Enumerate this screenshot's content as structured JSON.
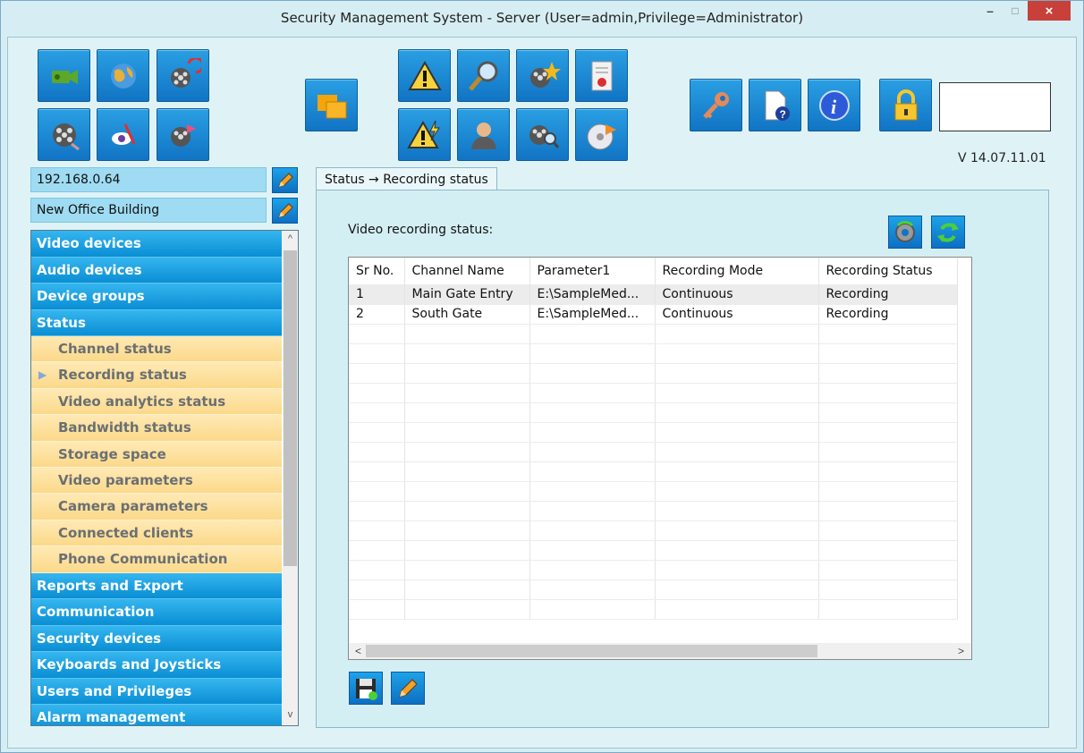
{
  "window": {
    "title": "Security Management System - Server (User=admin,Privilege=Administrator)",
    "min_label": "–",
    "max_label": "□",
    "close_label": "×"
  },
  "toolbar": {
    "buttons": [
      {
        "name": "camera-icon"
      },
      {
        "name": "globe-icon"
      },
      {
        "name": "film-refresh-icon"
      },
      {
        "name": "film-reel-icon"
      },
      {
        "name": "eye-pointer-icon"
      },
      {
        "name": "film-export-icon"
      },
      {
        "name": "windows-icon"
      },
      {
        "name": "warning-icon"
      },
      {
        "name": "magnifier-icon"
      },
      {
        "name": "film-star-icon"
      },
      {
        "name": "report-icon"
      },
      {
        "name": "warning-lightning-icon"
      },
      {
        "name": "user-icon"
      },
      {
        "name": "film-search-icon"
      },
      {
        "name": "disc-export-icon"
      },
      {
        "name": "key-icon"
      },
      {
        "name": "help-document-icon"
      },
      {
        "name": "info-icon"
      },
      {
        "name": "lock-icon"
      }
    ],
    "version": "V 14.07.11.01"
  },
  "server": {
    "ip": "192.168.0.64",
    "site": "New Office Building"
  },
  "nav": {
    "top_items": [
      "Video devices",
      "Audio devices",
      "Device groups",
      "Status"
    ],
    "sub_items": [
      "Channel status",
      "Recording status",
      "Video analytics status",
      "Bandwidth status",
      "Storage space",
      "Video parameters",
      "Camera parameters",
      "Connected clients",
      "Phone Communication"
    ],
    "bottom_items": [
      "Reports and Export",
      "Communication",
      "Security devices",
      "Keyboards and Joysticks",
      "Users and Privileges",
      "Alarm management"
    ],
    "scroll_up": "^",
    "scroll_down": "v"
  },
  "main": {
    "tab_label": "Status → Recording status",
    "section_label": "Video recording status:",
    "columns": [
      "Sr No.",
      "Channel Name",
      "Parameter1",
      "Recording Mode",
      "Recording Status"
    ],
    "rows": [
      [
        "1",
        "Main Gate Entry",
        "E:\\SampleMed...",
        "Continuous",
        "Recording"
      ],
      [
        "2",
        "South Gate",
        "E:\\SampleMed...",
        "Continuous",
        "Recording"
      ]
    ],
    "scroll_left": "<",
    "scroll_right": ">"
  },
  "colors": {
    "nav_blue": "#0a8ed4",
    "nav_sub": "#fbd98a",
    "button_blue": "#1174c4",
    "close_red": "#c7403a"
  }
}
